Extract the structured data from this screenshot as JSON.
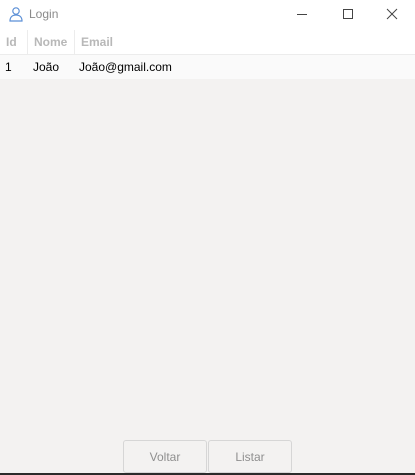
{
  "window": {
    "title": "Login",
    "app_icon": "user-icon",
    "controls": [
      "minimize-icon",
      "maximize-icon",
      "close-icon"
    ]
  },
  "table": {
    "columns": [
      "Id",
      "Nome",
      "Email"
    ],
    "rows": [
      [
        "1",
        "João",
        "João@gmail.com"
      ]
    ]
  },
  "buttons": {
    "voltar": "Voltar",
    "listar": "Listar"
  }
}
